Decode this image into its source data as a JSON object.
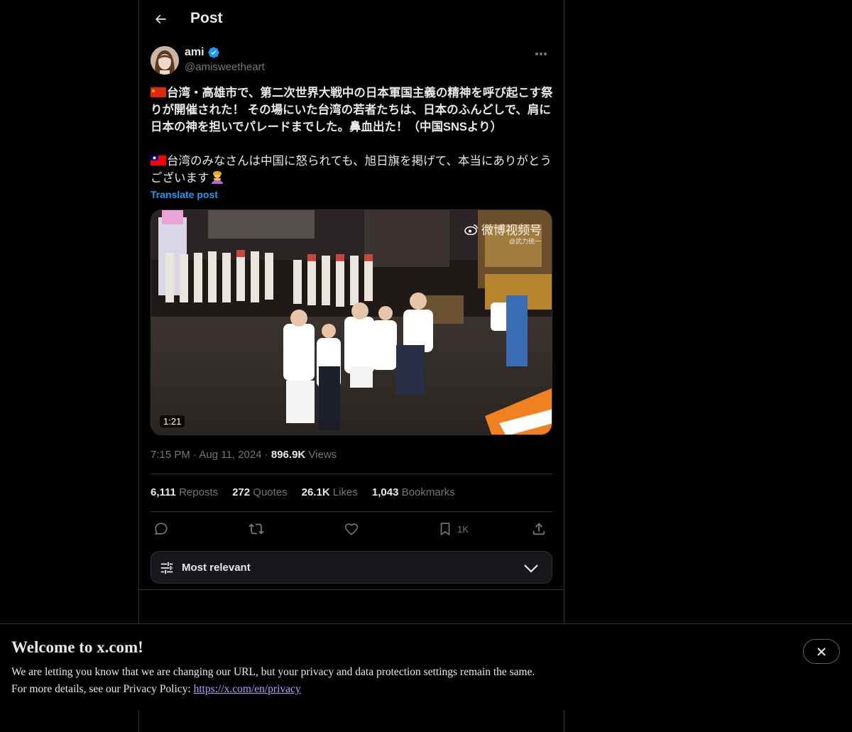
{
  "header": {
    "title": "Post",
    "back_icon": "arrow-left-icon"
  },
  "author": {
    "display_name": "ami",
    "handle": "@amisweetheart",
    "verified": true,
    "verified_color": "#1d9bf0"
  },
  "post": {
    "text_line_1": "台湾・高雄市で、第二次世界大戦中の日本軍国主義の精神を呼び起こす祭りが開催された！ その場にいた台湾の若者たちは、日本のふんどしで、肩に日本の神を担いでパレードまでした。鼻血出た！（中国SNSより）",
    "flag_1": "china-flag-icon",
    "text_line_2": "台湾のみなさんは中国に怒られても、旭日旗を掲げて、本当にありがとうございます",
    "flag_2": "taiwan-flag-icon",
    "emoji": "bowing-person-icon",
    "translate_label": "Translate post"
  },
  "media": {
    "duration": "1:21",
    "watermark": "微博视频号",
    "watermark_sub": "@武力统一"
  },
  "meta": {
    "time": "7:15 PM",
    "date": "Aug 11, 2024",
    "views_count": "896.9K",
    "views_label": "Views"
  },
  "stats": {
    "reposts_count": "6,111",
    "reposts_label": "Reposts",
    "quotes_count": "272",
    "quotes_label": "Quotes",
    "likes_count": "26.1K",
    "likes_label": "Likes",
    "bookmarks_count": "1,043",
    "bookmarks_label": "Bookmarks"
  },
  "actions": {
    "bookmark_count": "1K"
  },
  "sort": {
    "label": "Most relevant"
  },
  "banner": {
    "title": "Welcome to x.com!",
    "line_1": "We are letting you know that we are changing our URL, but your privacy and data protection settings remain the same.",
    "line_2_prefix": "For more details, see our Privacy Policy: ",
    "link": "https://x.com/en/privacy"
  }
}
